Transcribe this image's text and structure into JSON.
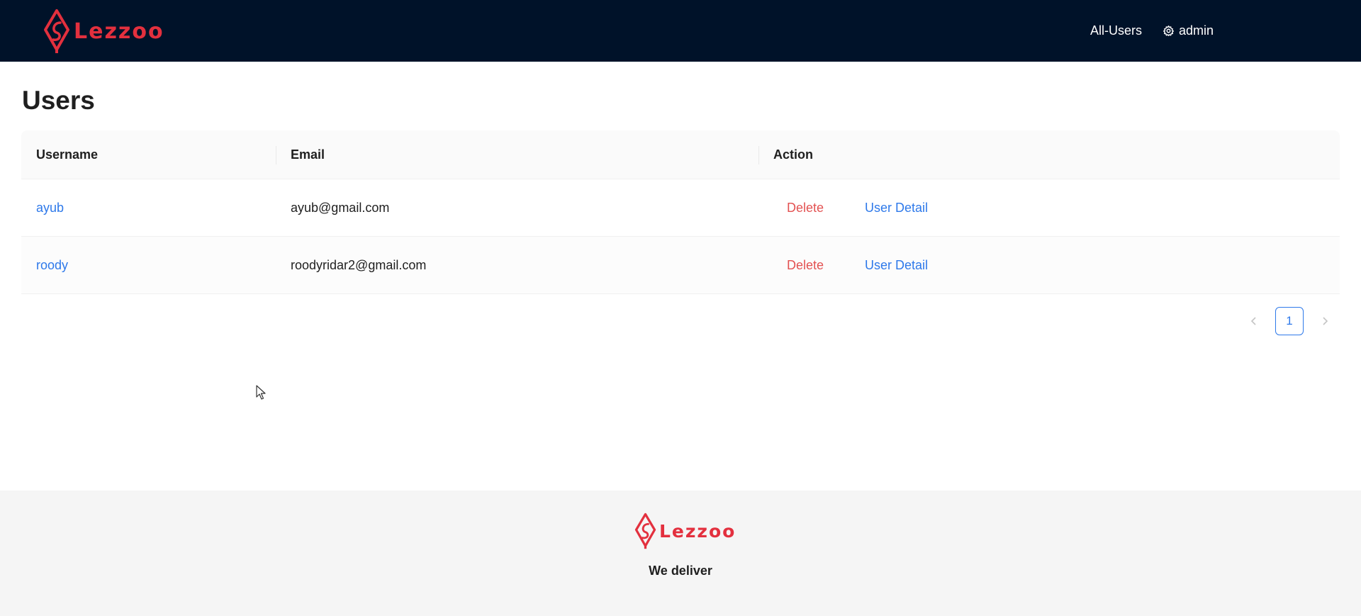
{
  "brand": {
    "name": "Lezzoo",
    "color": "#e3303e",
    "tagline": "We deliver"
  },
  "header": {
    "nav": {
      "all_users": "All-Users",
      "admin": "admin",
      "admin_icon": "gear-icon"
    }
  },
  "main": {
    "title": "Users",
    "table": {
      "columns": [
        "Username",
        "Email",
        "Action"
      ],
      "rows": [
        {
          "username": "ayub",
          "email": "ayub@gmail.com",
          "delete_label": "Delete",
          "detail_label": "User Detail"
        },
        {
          "username": "roody",
          "email": "roodyridar2@gmail.com",
          "delete_label": "Delete",
          "detail_label": "User Detail"
        }
      ]
    },
    "pagination": {
      "current_page": "1",
      "prev_icon": "chevron-left-icon",
      "next_icon": "chevron-right-icon"
    }
  },
  "colors": {
    "header_bg": "#001229",
    "link": "#2e79ea",
    "danger": "#e35252",
    "footer_bg": "#f5f5f5"
  }
}
